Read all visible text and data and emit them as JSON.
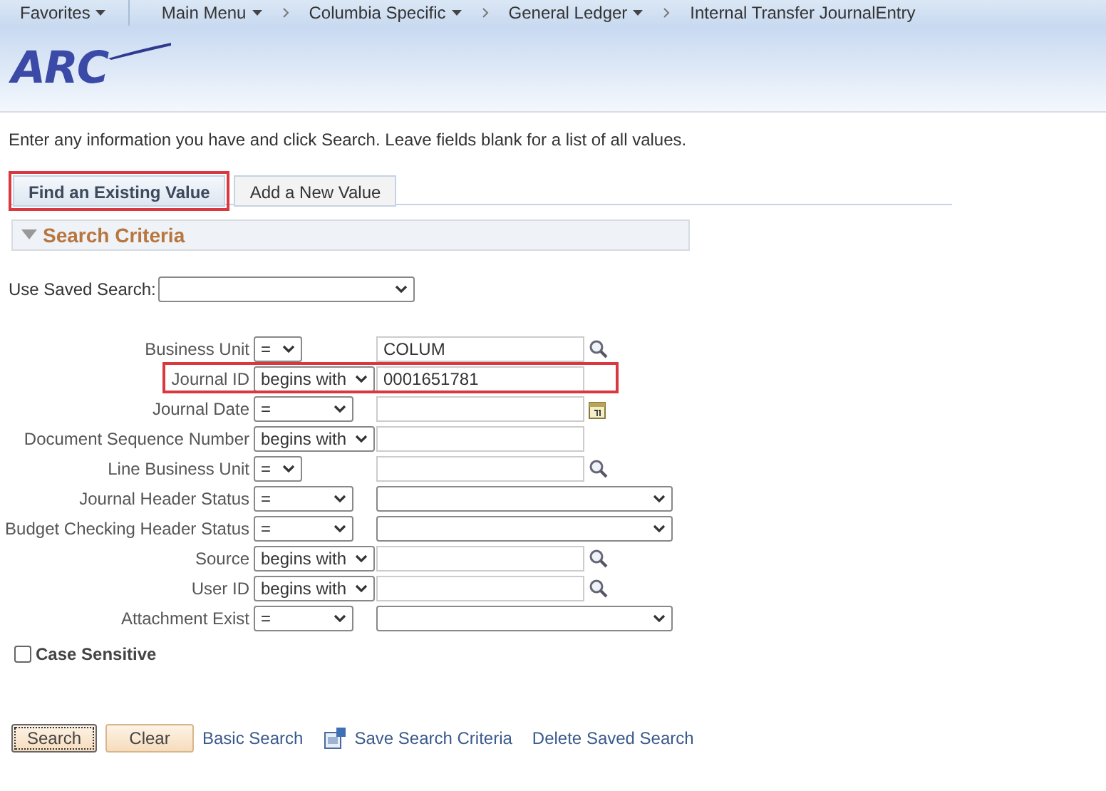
{
  "nav": {
    "items": [
      {
        "label": "Favorites",
        "kind": "menu"
      },
      {
        "label": "Main Menu",
        "kind": "menu"
      },
      {
        "label": "Columbia Specific",
        "kind": "crumb-menu"
      },
      {
        "label": "General Ledger",
        "kind": "crumb-menu"
      },
      {
        "label": "Internal Transfer JournalEntry",
        "kind": "crumb"
      }
    ]
  },
  "logo": {
    "text": "ARC"
  },
  "instructions": "Enter any information you have and click Search. Leave fields blank for a list of all values.",
  "tabs": [
    {
      "label": "Find an Existing Value",
      "selected": true,
      "highlighted": true
    },
    {
      "label": "Add a New Value",
      "selected": false,
      "highlighted": false
    }
  ],
  "section": {
    "title": "Search Criteria",
    "expanded": true
  },
  "saved_search": {
    "label": "Use Saved Search:"
  },
  "criteria": [
    {
      "label": "Business Unit",
      "operator": "=",
      "kind": "lookup",
      "value": "COLUM",
      "highlighted": false
    },
    {
      "label": "Journal ID",
      "operator": "begins with",
      "kind": "text",
      "value": "0001651781",
      "highlighted": true
    },
    {
      "label": "Journal Date",
      "operator": "=",
      "kind": "date",
      "highlighted": false
    },
    {
      "label": "Document Sequence Number",
      "operator": "begins with",
      "kind": "text",
      "highlighted": false
    },
    {
      "label": "Line Business Unit",
      "operator": "=",
      "kind": "lookup",
      "highlighted": false
    },
    {
      "label": "Journal Header Status",
      "operator": "=",
      "kind": "select",
      "highlighted": false
    },
    {
      "label": "Budget Checking Header Status",
      "operator": "=",
      "kind": "select",
      "highlighted": false
    },
    {
      "label": "Source",
      "operator": "begins with",
      "kind": "lookup",
      "highlighted": false
    },
    {
      "label": "User ID",
      "operator": "begins with",
      "kind": "lookup",
      "highlighted": false
    },
    {
      "label": "Attachment Exist",
      "operator": "=",
      "kind": "select",
      "highlighted": false
    }
  ],
  "case_sensitive": {
    "label": "Case Sensitive",
    "checked": false
  },
  "buttons": [
    {
      "label": "Search",
      "kind": "button",
      "focused": true
    },
    {
      "label": "Clear",
      "kind": "button",
      "focused": false
    },
    {
      "label": "Basic Search",
      "kind": "link"
    },
    {
      "label": "Save Search Criteria",
      "kind": "icon-link"
    },
    {
      "label": "Delete Saved Search",
      "kind": "link"
    }
  ]
}
